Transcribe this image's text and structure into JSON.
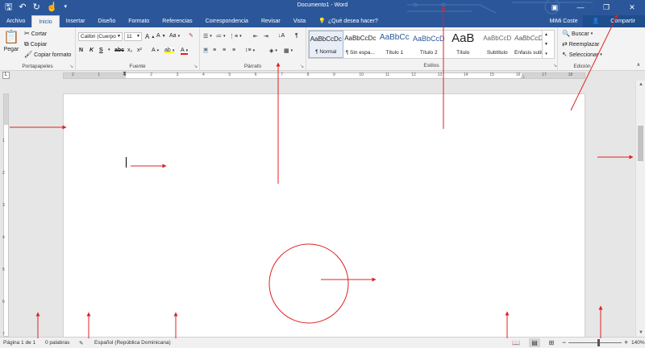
{
  "window": {
    "title": "Documento1 - Word",
    "qat": {
      "save_icon": "save-icon",
      "undo_icon": "undo-icon",
      "redo_icon": "redo-icon",
      "touch_icon": "touch-mode-icon"
    }
  },
  "tabs": [
    {
      "label": "Archivo"
    },
    {
      "label": "Inicio"
    },
    {
      "label": "Insertar"
    },
    {
      "label": "Diseño"
    },
    {
      "label": "Formato"
    },
    {
      "label": "Referencias"
    },
    {
      "label": "Correspondencia"
    },
    {
      "label": "Revisar"
    },
    {
      "label": "Vista"
    }
  ],
  "tell_me": "¿Qué desea hacer?",
  "user": "MiMi Coste",
  "share": "Compartir",
  "ribbon": {
    "clipboard": {
      "label": "Portapapeles",
      "paste": "Pegar",
      "cut": "Cortar",
      "copy": "Copiar",
      "format_painter": "Copiar formato"
    },
    "font": {
      "label": "Fuente",
      "font_name": "Calibri (Cuerpo",
      "font_size": "11",
      "bold": "N",
      "italic": "K",
      "underline": "S",
      "strike": "abc",
      "subscript": "x₂",
      "superscript": "x²",
      "change_case": "Aa",
      "grow": "A",
      "shrink": "A"
    },
    "paragraph": {
      "label": "Párrafo",
      "show_marks": "¶"
    },
    "styles": {
      "label": "Estilos",
      "items": [
        {
          "sample": "AaBbCcDc",
          "name": "¶ Normal"
        },
        {
          "sample": "AaBbCcDc",
          "name": "¶ Sin espa..."
        },
        {
          "sample": "AaBbCc",
          "name": "Título 1"
        },
        {
          "sample": "AaBbCcD",
          "name": "Título 2"
        },
        {
          "sample": "AaB",
          "name": "Título"
        },
        {
          "sample": "AaBbCcD",
          "name": "Subtítulo"
        },
        {
          "sample": "AaBbCcDc",
          "name": "Énfasis sutil"
        }
      ]
    },
    "editing": {
      "label": "Edición",
      "find": "Buscar",
      "replace": "Reemplazar",
      "select": "Seleccionar"
    }
  },
  "ruler_numbers": [
    "2",
    "1",
    "1",
    "2",
    "3",
    "4",
    "5",
    "6",
    "7",
    "8",
    "9",
    "10",
    "11",
    "12",
    "13",
    "14",
    "15",
    "16",
    "17",
    "18"
  ],
  "vruler_numbers": [
    "1",
    "2",
    "3",
    "4",
    "5",
    "6",
    "7"
  ],
  "status": {
    "page": "Página 1 de 1",
    "words": "0 palabras",
    "language": "Español (República Dominicana)",
    "zoom": "140%"
  },
  "colors": {
    "brand": "#2b579a",
    "annotation": "#e02020"
  }
}
